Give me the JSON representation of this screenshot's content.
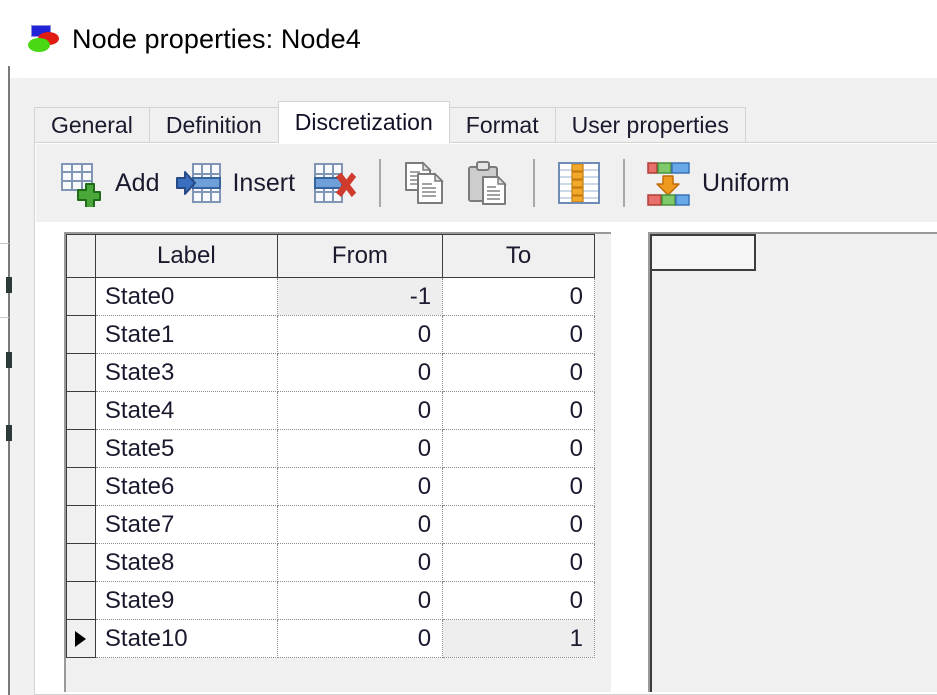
{
  "window": {
    "title": "Node properties: Node4",
    "icon": "node-properties-icon"
  },
  "tabs": [
    {
      "label": "General",
      "name": "tab-general",
      "active": false
    },
    {
      "label": "Definition",
      "name": "tab-definition",
      "active": false
    },
    {
      "label": "Discretization",
      "name": "tab-discretization",
      "active": true
    },
    {
      "label": "Format",
      "name": "tab-format",
      "active": false
    },
    {
      "label": "User properties",
      "name": "tab-user-properties",
      "active": false
    }
  ],
  "toolbar": {
    "add_label": "Add",
    "insert_label": "Insert",
    "delete_label": "",
    "copy_label": "",
    "paste_label": "",
    "columns_label": "",
    "uniform_label": "Uniform",
    "icons": {
      "add": "grid-plus-icon",
      "insert": "grid-insert-row-icon",
      "delete": "grid-delete-row-icon",
      "copy": "copy-icon",
      "paste": "paste-icon",
      "columns": "grid-columns-icon",
      "uniform": "uniform-distribute-icon"
    }
  },
  "grid": {
    "columns": [
      "",
      "Label",
      "From",
      "To"
    ],
    "rows": [
      {
        "marker": "",
        "label": "State0",
        "from": "-1",
        "to": "0",
        "from_shaded": true,
        "to_shaded": false
      },
      {
        "marker": "",
        "label": "State1",
        "from": "0",
        "to": "0",
        "from_shaded": false,
        "to_shaded": false
      },
      {
        "marker": "",
        "label": "State3",
        "from": "0",
        "to": "0",
        "from_shaded": false,
        "to_shaded": false
      },
      {
        "marker": "",
        "label": "State4",
        "from": "0",
        "to": "0",
        "from_shaded": false,
        "to_shaded": false
      },
      {
        "marker": "",
        "label": "State5",
        "from": "0",
        "to": "0",
        "from_shaded": false,
        "to_shaded": false
      },
      {
        "marker": "",
        "label": "State6",
        "from": "0",
        "to": "0",
        "from_shaded": false,
        "to_shaded": false
      },
      {
        "marker": "",
        "label": "State7",
        "from": "0",
        "to": "0",
        "from_shaded": false,
        "to_shaded": false
      },
      {
        "marker": "",
        "label": "State8",
        "from": "0",
        "to": "0",
        "from_shaded": false,
        "to_shaded": false
      },
      {
        "marker": "",
        "label": "State9",
        "from": "0",
        "to": "0",
        "from_shaded": false,
        "to_shaded": false
      },
      {
        "marker": "▶",
        "label": "State10",
        "from": "0",
        "to": "1",
        "from_shaded": false,
        "to_shaded": true
      }
    ]
  },
  "right_panel": {
    "header_cell": "",
    "rows": []
  },
  "colors": {
    "dialog_background": "#f0f0f0",
    "page_background": "#ffffff",
    "text": "#1a1a2e",
    "grid_border": "#3c3c3c",
    "grid_dotted": "#8c8c8c",
    "shaded_cell": "#eeeeee",
    "icon_green": "#3ea832",
    "icon_red": "#c8352b",
    "icon_blue": "#3a66b0",
    "icon_orange": "#e8961e"
  }
}
